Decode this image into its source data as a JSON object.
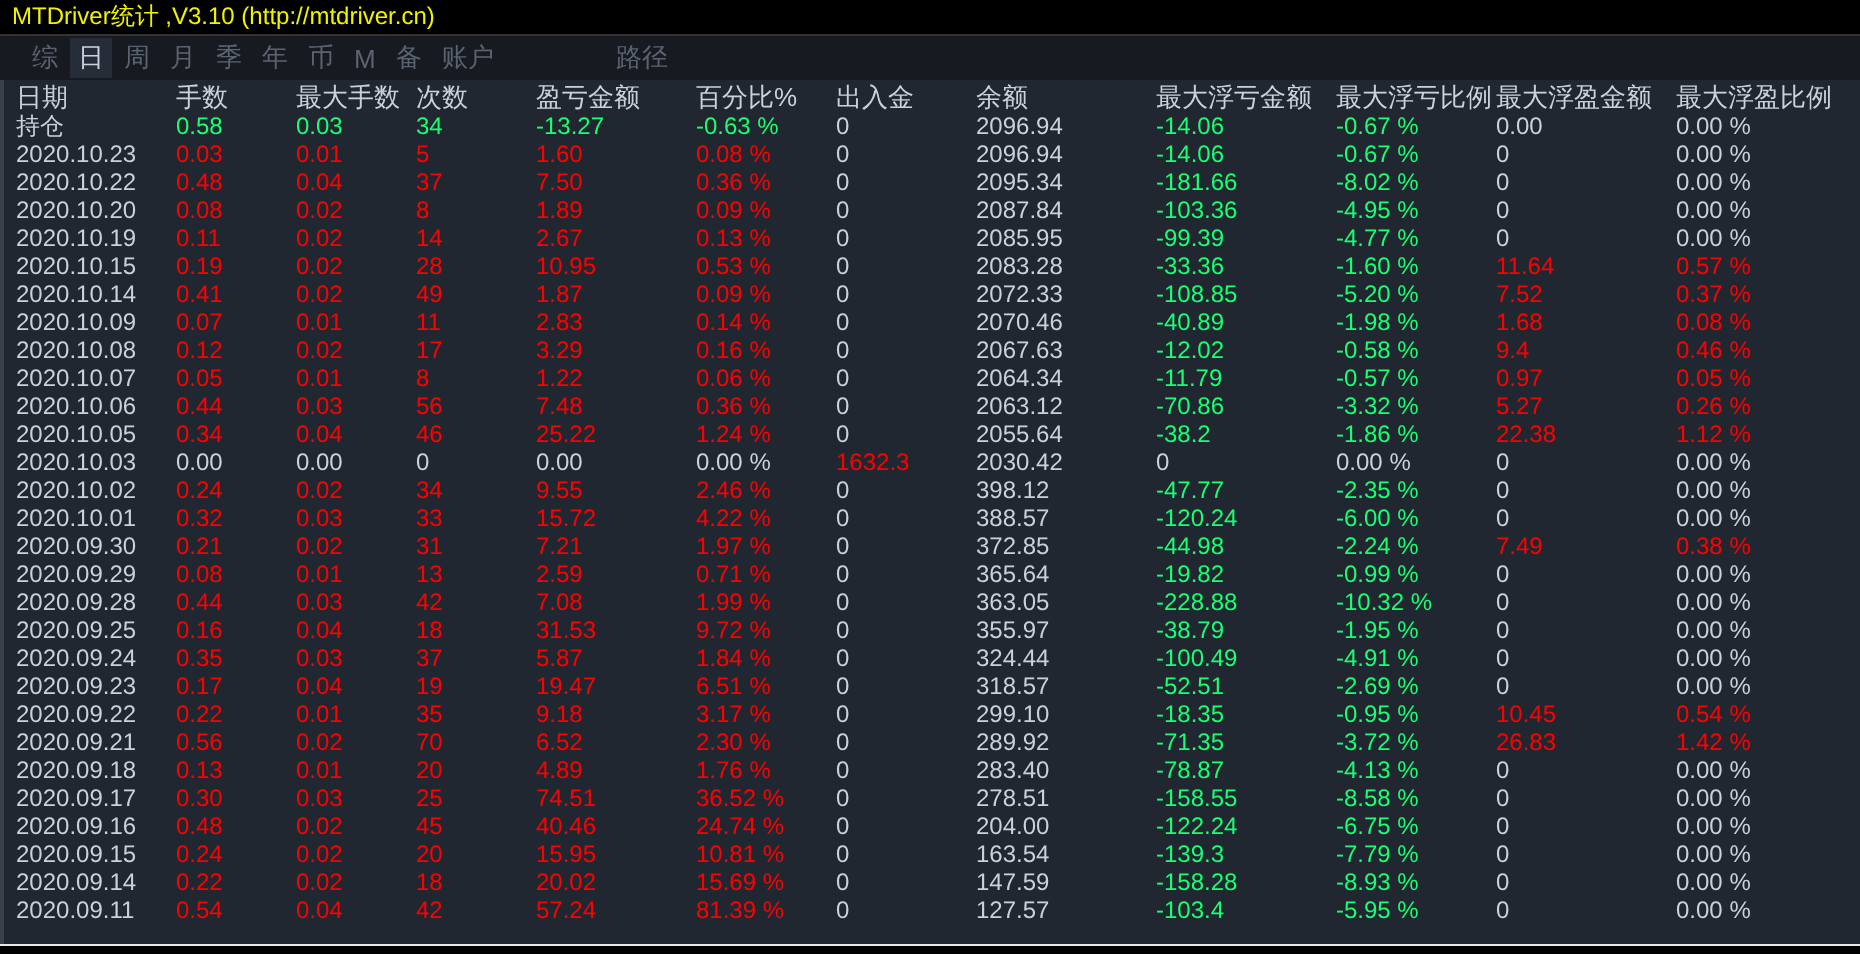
{
  "window": {
    "title": "MTDriver统计 ,V3.10 (http://mtdriver.cn)"
  },
  "tabs": [
    {
      "label": "综",
      "selected": false
    },
    {
      "label": "日",
      "selected": true
    },
    {
      "label": "周",
      "selected": false
    },
    {
      "label": "月",
      "selected": false
    },
    {
      "label": "季",
      "selected": false
    },
    {
      "label": "年",
      "selected": false
    },
    {
      "label": "币",
      "selected": false
    },
    {
      "label": "M",
      "selected": false
    },
    {
      "label": "备",
      "selected": false
    },
    {
      "label": "账户",
      "selected": false
    }
  ],
  "path_tab": {
    "label": "路径",
    "selected": false
  },
  "table": {
    "columns": [
      "日期",
      "手数",
      "最大手数",
      "次数",
      "盈亏金额",
      "百分比%",
      "出入金",
      "余额",
      "最大浮亏金额",
      "最大浮亏比例",
      "最大浮盈金额",
      "最大浮盈比例"
    ],
    "rows": [
      {
        "kind": "holding",
        "float_gain": false,
        "cells": [
          "持仓",
          "0.58",
          "0.03",
          "34",
          "-13.27",
          "-0.63 %",
          "0",
          "2096.94",
          "-14.06",
          "-0.67 %",
          "0.00",
          "0.00 %"
        ]
      },
      {
        "kind": "day",
        "float_gain": false,
        "cells": [
          "2020.10.23",
          "0.03",
          "0.01",
          "5",
          "1.60",
          "0.08 %",
          "0",
          "2096.94",
          "-14.06",
          "-0.67 %",
          "0",
          "0.00 %"
        ]
      },
      {
        "kind": "day",
        "float_gain": false,
        "cells": [
          "2020.10.22",
          "0.48",
          "0.04",
          "37",
          "7.50",
          "0.36 %",
          "0",
          "2095.34",
          "-181.66",
          "-8.02 %",
          "0",
          "0.00 %"
        ]
      },
      {
        "kind": "day",
        "float_gain": false,
        "cells": [
          "2020.10.20",
          "0.08",
          "0.02",
          "8",
          "1.89",
          "0.09 %",
          "0",
          "2087.84",
          "-103.36",
          "-4.95 %",
          "0",
          "0.00 %"
        ]
      },
      {
        "kind": "day",
        "float_gain": false,
        "cells": [
          "2020.10.19",
          "0.11",
          "0.02",
          "14",
          "2.67",
          "0.13 %",
          "0",
          "2085.95",
          "-99.39",
          "-4.77 %",
          "0",
          "0.00 %"
        ]
      },
      {
        "kind": "day",
        "float_gain": true,
        "cells": [
          "2020.10.15",
          "0.19",
          "0.02",
          "28",
          "10.95",
          "0.53 %",
          "0",
          "2083.28",
          "-33.36",
          "-1.60 %",
          "11.64",
          "0.57 %"
        ]
      },
      {
        "kind": "day",
        "float_gain": true,
        "cells": [
          "2020.10.14",
          "0.41",
          "0.02",
          "49",
          "1.87",
          "0.09 %",
          "0",
          "2072.33",
          "-108.85",
          "-5.20 %",
          "7.52",
          "0.37 %"
        ]
      },
      {
        "kind": "day",
        "float_gain": true,
        "cells": [
          "2020.10.09",
          "0.07",
          "0.01",
          "11",
          "2.83",
          "0.14 %",
          "0",
          "2070.46",
          "-40.89",
          "-1.98 %",
          "1.68",
          "0.08 %"
        ]
      },
      {
        "kind": "day",
        "float_gain": true,
        "cells": [
          "2020.10.08",
          "0.12",
          "0.02",
          "17",
          "3.29",
          "0.16 %",
          "0",
          "2067.63",
          "-12.02",
          "-0.58 %",
          "9.4",
          "0.46 %"
        ]
      },
      {
        "kind": "day",
        "float_gain": true,
        "cells": [
          "2020.10.07",
          "0.05",
          "0.01",
          "8",
          "1.22",
          "0.06 %",
          "0",
          "2064.34",
          "-11.79",
          "-0.57 %",
          "0.97",
          "0.05 %"
        ]
      },
      {
        "kind": "day",
        "float_gain": true,
        "cells": [
          "2020.10.06",
          "0.44",
          "0.03",
          "56",
          "7.48",
          "0.36 %",
          "0",
          "2063.12",
          "-70.86",
          "-3.32 %",
          "5.27",
          "0.26 %"
        ]
      },
      {
        "kind": "day",
        "float_gain": true,
        "cells": [
          "2020.10.05",
          "0.34",
          "0.04",
          "46",
          "25.22",
          "1.24 %",
          "0",
          "2055.64",
          "-38.2",
          "-1.86 %",
          "22.38",
          "1.12 %"
        ]
      },
      {
        "kind": "transfer",
        "float_gain": false,
        "cells": [
          "2020.10.03",
          "0.00",
          "0.00",
          "0",
          "0.00",
          "0.00 %",
          "1632.3",
          "2030.42",
          "0",
          "0.00 %",
          "0",
          "0.00 %"
        ]
      },
      {
        "kind": "day",
        "float_gain": false,
        "cells": [
          "2020.10.02",
          "0.24",
          "0.02",
          "34",
          "9.55",
          "2.46 %",
          "0",
          "398.12",
          "-47.77",
          "-2.35 %",
          "0",
          "0.00 %"
        ]
      },
      {
        "kind": "day",
        "float_gain": false,
        "cells": [
          "2020.10.01",
          "0.32",
          "0.03",
          "33",
          "15.72",
          "4.22 %",
          "0",
          "388.57",
          "-120.24",
          "-6.00 %",
          "0",
          "0.00 %"
        ]
      },
      {
        "kind": "day",
        "float_gain": true,
        "cells": [
          "2020.09.30",
          "0.21",
          "0.02",
          "31",
          "7.21",
          "1.97 %",
          "0",
          "372.85",
          "-44.98",
          "-2.24 %",
          "7.49",
          "0.38 %"
        ]
      },
      {
        "kind": "day",
        "float_gain": false,
        "cells": [
          "2020.09.29",
          "0.08",
          "0.01",
          "13",
          "2.59",
          "0.71 %",
          "0",
          "365.64",
          "-19.82",
          "-0.99 %",
          "0",
          "0.00 %"
        ]
      },
      {
        "kind": "day",
        "float_gain": false,
        "cells": [
          "2020.09.28",
          "0.44",
          "0.03",
          "42",
          "7.08",
          "1.99 %",
          "0",
          "363.05",
          "-228.88",
          "-10.32 %",
          "0",
          "0.00 %"
        ]
      },
      {
        "kind": "day",
        "float_gain": false,
        "cells": [
          "2020.09.25",
          "0.16",
          "0.04",
          "18",
          "31.53",
          "9.72 %",
          "0",
          "355.97",
          "-38.79",
          "-1.95 %",
          "0",
          "0.00 %"
        ]
      },
      {
        "kind": "day",
        "float_gain": false,
        "cells": [
          "2020.09.24",
          "0.35",
          "0.03",
          "37",
          "5.87",
          "1.84 %",
          "0",
          "324.44",
          "-100.49",
          "-4.91 %",
          "0",
          "0.00 %"
        ]
      },
      {
        "kind": "day",
        "float_gain": false,
        "cells": [
          "2020.09.23",
          "0.17",
          "0.04",
          "19",
          "19.47",
          "6.51 %",
          "0",
          "318.57",
          "-52.51",
          "-2.69 %",
          "0",
          "0.00 %"
        ]
      },
      {
        "kind": "day",
        "float_gain": true,
        "cells": [
          "2020.09.22",
          "0.22",
          "0.01",
          "35",
          "9.18",
          "3.17 %",
          "0",
          "299.10",
          "-18.35",
          "-0.95 %",
          "10.45",
          "0.54 %"
        ]
      },
      {
        "kind": "day",
        "float_gain": true,
        "cells": [
          "2020.09.21",
          "0.56",
          "0.02",
          "70",
          "6.52",
          "2.30 %",
          "0",
          "289.92",
          "-71.35",
          "-3.72 %",
          "26.83",
          "1.42 %"
        ]
      },
      {
        "kind": "day",
        "float_gain": false,
        "cells": [
          "2020.09.18",
          "0.13",
          "0.01",
          "20",
          "4.89",
          "1.76 %",
          "0",
          "283.40",
          "-78.87",
          "-4.13 %",
          "0",
          "0.00 %"
        ]
      },
      {
        "kind": "day",
        "float_gain": false,
        "cells": [
          "2020.09.17",
          "0.30",
          "0.03",
          "25",
          "74.51",
          "36.52 %",
          "0",
          "278.51",
          "-158.55",
          "-8.58 %",
          "0",
          "0.00 %"
        ]
      },
      {
        "kind": "day",
        "float_gain": false,
        "cells": [
          "2020.09.16",
          "0.48",
          "0.02",
          "45",
          "40.46",
          "24.74 %",
          "0",
          "204.00",
          "-122.24",
          "-6.75 %",
          "0",
          "0.00 %"
        ]
      },
      {
        "kind": "day",
        "float_gain": false,
        "cells": [
          "2020.09.15",
          "0.24",
          "0.02",
          "20",
          "15.95",
          "10.81 %",
          "0",
          "163.54",
          "-139.3",
          "-7.79 %",
          "0",
          "0.00 %"
        ]
      },
      {
        "kind": "day",
        "float_gain": false,
        "cells": [
          "2020.09.14",
          "0.22",
          "0.02",
          "18",
          "20.02",
          "15.69 %",
          "0",
          "147.59",
          "-158.28",
          "-8.93 %",
          "0",
          "0.00 %"
        ]
      },
      {
        "kind": "day",
        "float_gain": false,
        "cells": [
          "2020.09.11",
          "0.54",
          "0.04",
          "42",
          "57.24",
          "81.39 %",
          "0",
          "127.57",
          "-103.4",
          "-5.95 %",
          "0",
          "0.00 %"
        ]
      }
    ]
  }
}
